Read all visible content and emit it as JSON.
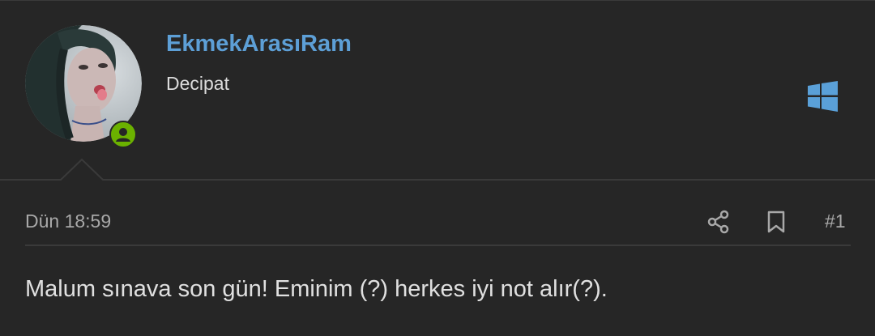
{
  "user": {
    "username": "EkmekArasıRam",
    "title": "Decipat",
    "avatar_icon": "avatar-photo",
    "online_badge_icon": "user-online-icon",
    "platform_icon": "windows-icon"
  },
  "post": {
    "date": "Dün 18:59",
    "number": "#1",
    "message": "Malum sınava son gün! Eminim (?) herkes iyi not alır(?)."
  },
  "actions": {
    "share_icon": "share-icon",
    "bookmark_icon": "bookmark-icon"
  },
  "colors": {
    "background": "#262626",
    "username": "#5d9fd6",
    "online_badge": "#6bb100",
    "platform_icon": "#5aa0d8",
    "divider": "#3a3a3a",
    "muted_text": "#a8a8a8"
  }
}
